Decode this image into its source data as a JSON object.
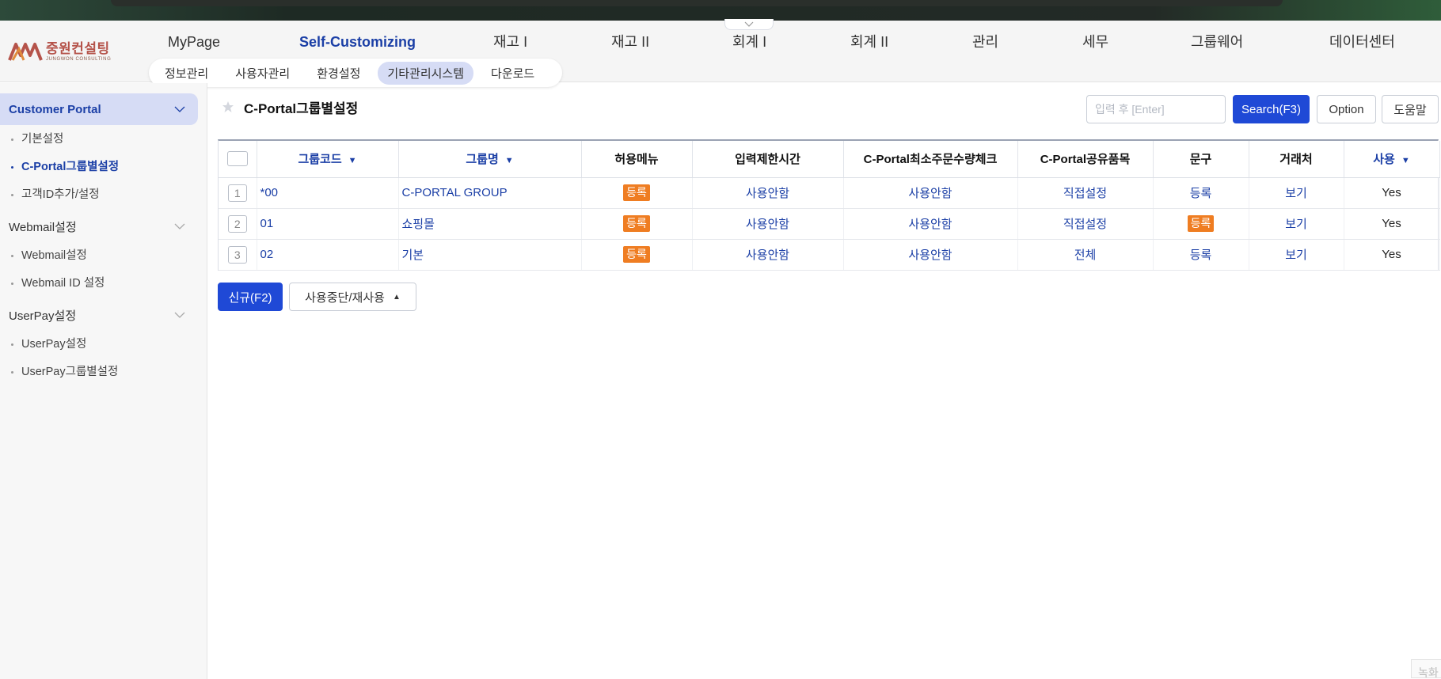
{
  "logo": {
    "text_ko": "중원컨설팅",
    "text_en": "JUNGWON CONSULTING"
  },
  "main_nav": [
    {
      "label": "MyPage",
      "active": false
    },
    {
      "label": "Self-Customizing",
      "active": true
    },
    {
      "label": "재고 I",
      "active": false
    },
    {
      "label": "재고 II",
      "active": false
    },
    {
      "label": "회계 I",
      "active": false
    },
    {
      "label": "회계 II",
      "active": false
    },
    {
      "label": "관리",
      "active": false
    },
    {
      "label": "세무",
      "active": false
    },
    {
      "label": "그룹웨어",
      "active": false
    },
    {
      "label": "데이터센터",
      "active": false
    }
  ],
  "sub_nav": [
    {
      "label": "정보관리",
      "active": false
    },
    {
      "label": "사용자관리",
      "active": false
    },
    {
      "label": "환경설정",
      "active": false
    },
    {
      "label": "기타관리시스템",
      "active": true
    },
    {
      "label": "다운로드",
      "active": false
    }
  ],
  "sidebar": {
    "groups": [
      {
        "label": "Customer Portal",
        "expanded": true,
        "active": true,
        "items": [
          {
            "label": "기본설정",
            "active": false
          },
          {
            "label": "C-Portal그룹별설정",
            "active": true
          },
          {
            "label": "고객ID추가/설정",
            "active": false
          }
        ]
      },
      {
        "label": "Webmail설정",
        "expanded": true,
        "active": false,
        "items": [
          {
            "label": "Webmail설정",
            "active": false
          },
          {
            "label": "Webmail ID 설정",
            "active": false
          }
        ]
      },
      {
        "label": "UserPay설정",
        "expanded": true,
        "active": false,
        "items": [
          {
            "label": "UserPay설정",
            "active": false
          },
          {
            "label": "UserPay그룹별설정",
            "active": false
          }
        ]
      }
    ]
  },
  "page": {
    "title": "C-Portal그룹별설정",
    "search_placeholder": "입력 후 [Enter]",
    "search_value": "",
    "search_button": "Search(F3)",
    "option_button": "Option",
    "help_button": "도움말"
  },
  "table": {
    "columns": [
      {
        "label": "그룹코드",
        "sortable": true
      },
      {
        "label": "그룹명",
        "sortable": true
      },
      {
        "label": "허용메뉴",
        "sortable": false
      },
      {
        "label": "입력제한시간",
        "sortable": false
      },
      {
        "label": "C-Portal최소주문수량체크",
        "sortable": false
      },
      {
        "label": "C-Portal공유품목",
        "sortable": false
      },
      {
        "label": "문구",
        "sortable": false
      },
      {
        "label": "거래처",
        "sortable": false
      },
      {
        "label": "사용",
        "sortable": true
      }
    ],
    "rows": [
      {
        "num": "1",
        "code": "*00",
        "name": "C-PORTAL GROUP",
        "menu": "등록",
        "time": "사용안함",
        "minqty": "사용안함",
        "shared": "직접설정",
        "phrase": "등록",
        "phrase_badge": false,
        "customer": "보기",
        "use": "Yes"
      },
      {
        "num": "2",
        "code": "01",
        "name": "쇼핑몰",
        "menu": "등록",
        "time": "사용안함",
        "minqty": "사용안함",
        "shared": "직접설정",
        "phrase": "등록",
        "phrase_badge": true,
        "customer": "보기",
        "use": "Yes"
      },
      {
        "num": "3",
        "code": "02",
        "name": "기본",
        "menu": "등록",
        "time": "사용안함",
        "minqty": "사용안함",
        "shared": "전체",
        "phrase": "등록",
        "phrase_badge": false,
        "customer": "보기",
        "use": "Yes"
      }
    ]
  },
  "actions": {
    "new_button": "신규(F2)",
    "toggle_button": "사용중단/재사용"
  },
  "corner_text": "녹화",
  "colors": {
    "primary": "#1f49d6",
    "accent_text": "#1b3fa6",
    "badge": "#ef7d22",
    "active_bg": "#d6dcf5"
  },
  "icons": [
    "chevron-down-icon",
    "star-icon",
    "sort-down-icon",
    "caret-up-icon"
  ]
}
